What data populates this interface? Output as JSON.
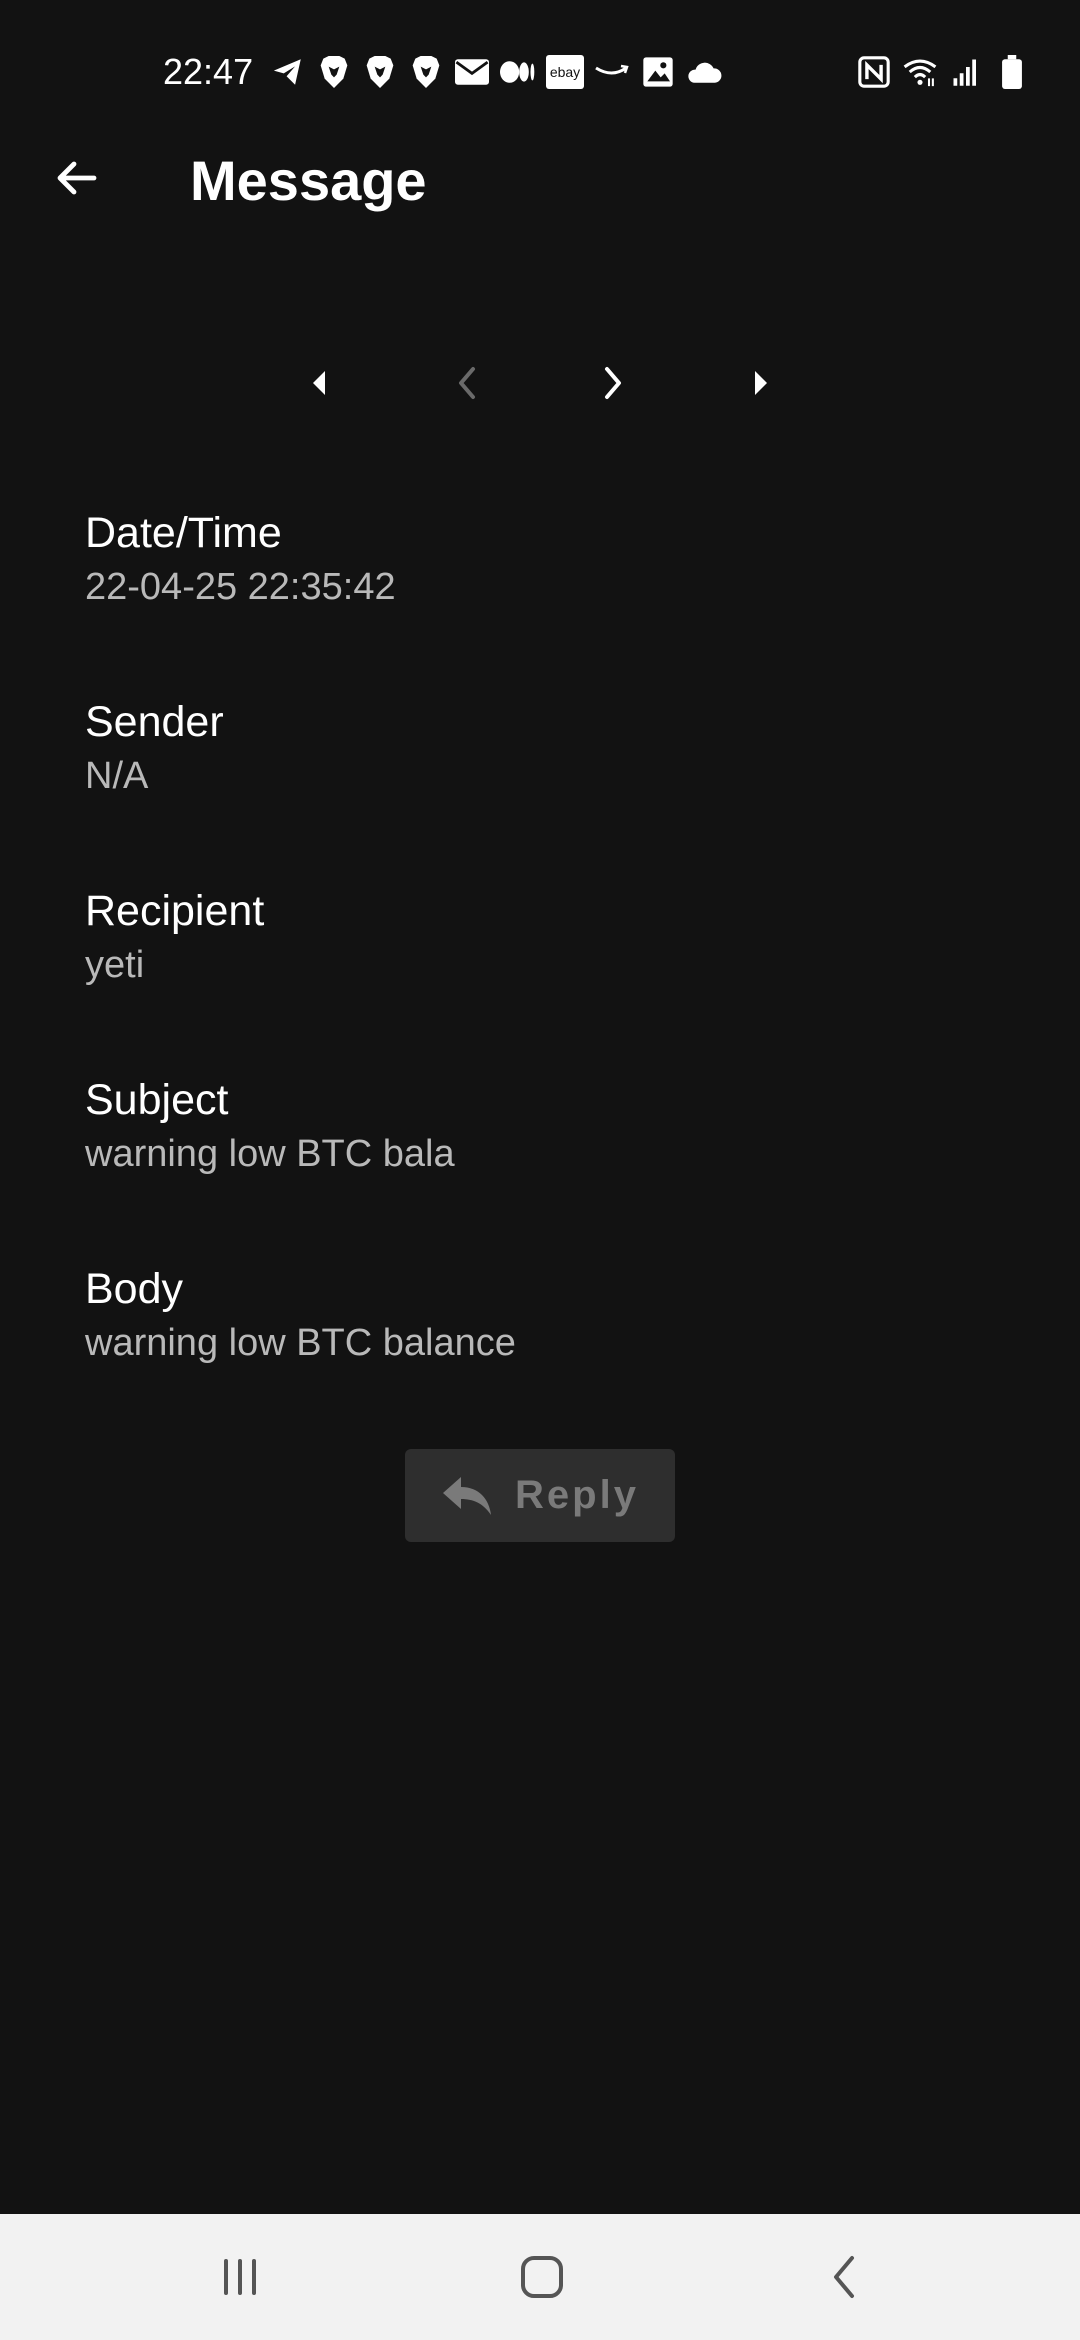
{
  "status_bar": {
    "time": "22:47",
    "ebay_label": "ebay",
    "left_icons": [
      "telegram-icon",
      "brave-icon",
      "brave-icon",
      "brave-icon",
      "mail-icon",
      "medium-icon",
      "ebay-icon",
      "amazon-icon",
      "gallery-icon",
      "cloud-icon"
    ],
    "right_icons": [
      "nfc-icon",
      "wifi-icon",
      "cell-signal-icon",
      "battery-icon"
    ]
  },
  "app_bar": {
    "title": "Message"
  },
  "pager": {
    "icons": [
      "first-page-icon",
      "prev-page-icon",
      "next-page-icon",
      "last-page-icon"
    ],
    "prev_disabled": true
  },
  "fields": {
    "datetime": {
      "label": "Date/Time",
      "value": "22-04-25 22:35:42"
    },
    "sender": {
      "label": "Sender",
      "value": "N/A"
    },
    "recipient": {
      "label": "Recipient",
      "value": "yeti"
    },
    "subject": {
      "label": "Subject",
      "value": "warning low BTC bala"
    },
    "body": {
      "label": "Body",
      "value": "warning low BTC balance"
    }
  },
  "reply_button": {
    "label": "Reply",
    "icon": "reply-icon",
    "disabled": true
  },
  "nav_bar": {
    "icons": [
      "recents-icon",
      "home-icon",
      "back-icon"
    ]
  },
  "colors": {
    "background": "#121212",
    "text_primary": "#ffffff",
    "text_secondary": "#b9b9b9",
    "disabled_button_bg": "#2e2e2e",
    "disabled_text": "#7a7a7a",
    "nav_bar_bg": "#f2f2f2"
  }
}
